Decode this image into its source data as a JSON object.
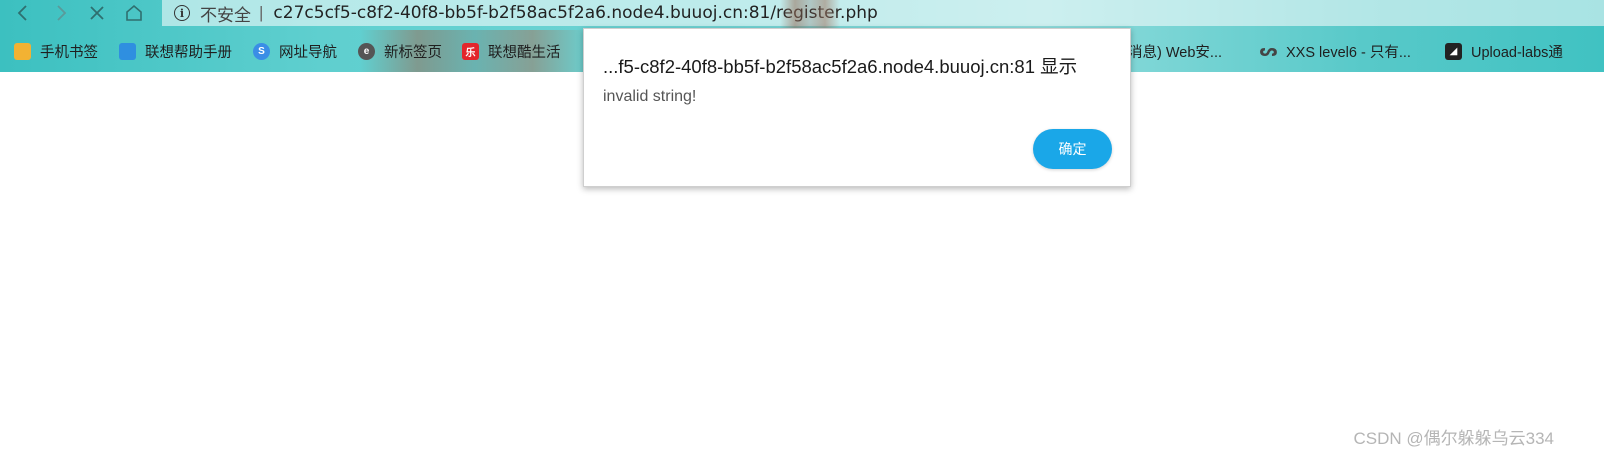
{
  "browser": {
    "security_label": "不安全",
    "address_separator": "|",
    "url": "c27c5cf5-c8f2-40f8-bb5f-b2f58ac5f2a6.node4.buuoj.cn:81/register.php",
    "info_icon_glyph": "i"
  },
  "bookmarks": [
    {
      "label": "手机书签",
      "icon": "phone-bookmark-icon",
      "color": "#f2b233"
    },
    {
      "label": "联想帮助手册",
      "icon": "lenovo-manual-icon",
      "color": "#2f8fe0"
    },
    {
      "label": "网址导航",
      "icon": "web-navigation-icon",
      "color": "#3a8ee6"
    },
    {
      "label": "新标签页",
      "icon": "new-tab-icon",
      "color": "#555555",
      "glyph": "e"
    },
    {
      "label": "联想酷生活",
      "icon": "lenovo-cool-life-icon",
      "color": "#e3262b",
      "glyph": "乐"
    },
    {
      "label": "消息) Web安...",
      "icon": "",
      "color": ""
    },
    {
      "label": "XXS level6 - 只有...",
      "icon": "xxs-level-icon",
      "color": "#555555"
    },
    {
      "label": "Upload-labs通",
      "icon": "upload-labs-icon",
      "color": "#222222"
    }
  ],
  "dialog": {
    "title": "...f5-c8f2-40f8-bb5f-b2f58ac5f2a6.node4.buuoj.cn:81 显示",
    "message": "invalid string!",
    "ok_label": "确定"
  },
  "watermark": "CSDN @偶尔躲躲乌云334",
  "colors": {
    "browser_chrome": "#5fcfcf",
    "ok_button": "#1aa7e8"
  }
}
